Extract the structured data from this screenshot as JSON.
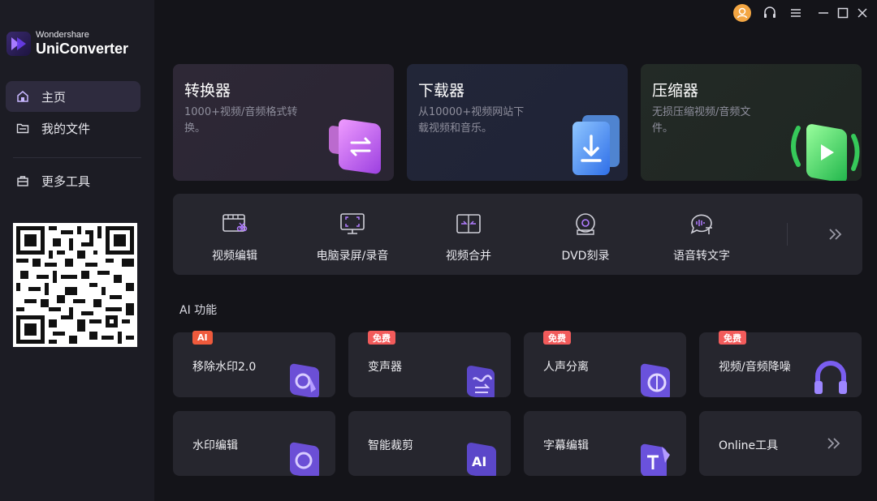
{
  "brand": {
    "small": "Wondershare",
    "name": "UniConverter"
  },
  "sidebar": {
    "items": [
      {
        "label": "主页",
        "icon": "home-icon",
        "active": true
      },
      {
        "label": "我的文件",
        "icon": "folder-icon",
        "active": false
      },
      {
        "label": "更多工具",
        "icon": "toolbox-icon",
        "active": false
      }
    ]
  },
  "titlebar": {
    "buttons": [
      "avatar-icon",
      "headset-icon",
      "menu-icon",
      "minimize-icon",
      "maximize-icon",
      "close-icon"
    ]
  },
  "main_cards": [
    {
      "title": "转换器",
      "desc": "1000+视频/音频格式转换。",
      "accent": "#c45cf0"
    },
    {
      "title": "下载器",
      "desc": "从10000+视频网站下载视频和音乐。",
      "accent": "#4a8cf7"
    },
    {
      "title": "压缩器",
      "desc": "无损压缩视频/音频文件。",
      "accent": "#3fd46a"
    }
  ],
  "tools": [
    {
      "label": "视频编辑",
      "icon": "video-edit-icon"
    },
    {
      "label": "电脑录屏/录音",
      "icon": "screen-record-icon"
    },
    {
      "label": "视频合并",
      "icon": "merge-icon"
    },
    {
      "label": "DVD刻录",
      "icon": "dvd-icon"
    },
    {
      "label": "语音转文字",
      "icon": "speech-to-text-icon"
    }
  ],
  "ai_section": {
    "title": "AI 功能",
    "cards": [
      {
        "label": "移除水印2.0",
        "badge": "AI"
      },
      {
        "label": "变声器",
        "badge": "免费"
      },
      {
        "label": "人声分离",
        "badge": "免费"
      },
      {
        "label": "视频/音频降噪",
        "badge": "免费"
      },
      {
        "label": "水印编辑",
        "badge": ""
      },
      {
        "label": "智能裁剪",
        "badge": ""
      },
      {
        "label": "字幕编辑",
        "badge": ""
      },
      {
        "label": "Online工具",
        "badge": ""
      }
    ]
  },
  "colors": {
    "sidebar_bg": "#1c1c24",
    "card_bg": "#26262e",
    "accent_purple": "#8b5cf6",
    "badge_red": "#f25b5b"
  }
}
